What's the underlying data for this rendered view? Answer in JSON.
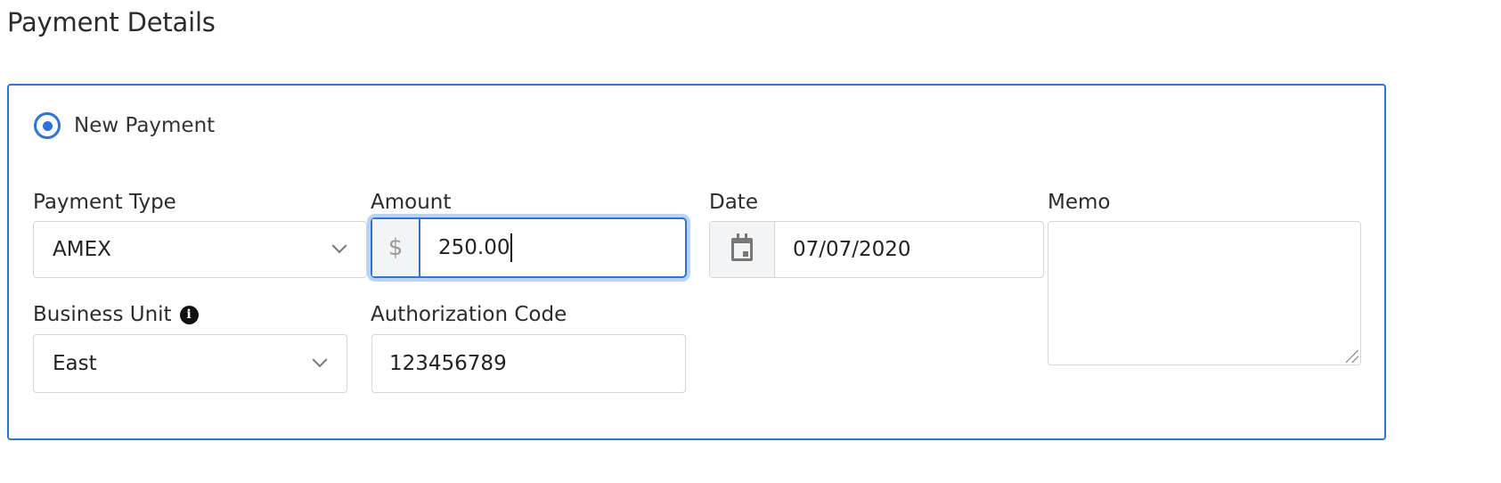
{
  "page": {
    "title": "Payment Details"
  },
  "new_payment": {
    "label": "New Payment",
    "selected": true
  },
  "fields": {
    "payment_type": {
      "label": "Payment Type",
      "value": "AMEX"
    },
    "amount": {
      "label": "Amount",
      "prefix": "$",
      "value": "250.00"
    },
    "date": {
      "label": "Date",
      "value": "07/07/2020"
    },
    "memo": {
      "label": "Memo",
      "value": ""
    },
    "business_unit": {
      "label": "Business Unit",
      "value": "East",
      "info_icon": "info-icon"
    },
    "authorization_code": {
      "label": "Authorization Code",
      "value": "123456789"
    }
  },
  "colors": {
    "accent": "#2f73d6",
    "focus_ring": "#b9d3f7",
    "border": "#d5d5d5",
    "addon_bg": "#f3f4f6"
  }
}
